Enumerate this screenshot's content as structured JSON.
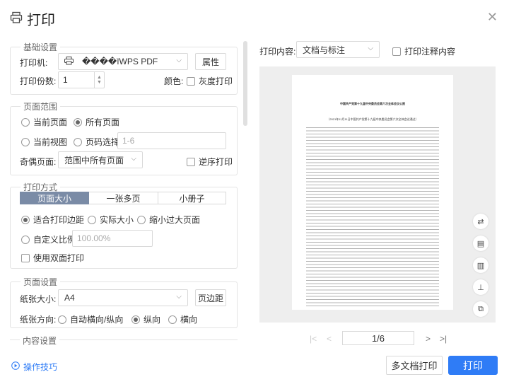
{
  "dialog": {
    "title": "打印"
  },
  "basic": {
    "legend": "基础设置",
    "printer_label": "打印机:",
    "printer_value": "����ĭWPS PDF",
    "props_button": "属性",
    "copies_label": "打印份数:",
    "copies_value": "1",
    "color_label": "颜色:",
    "gray_label": "灰度打印"
  },
  "range": {
    "legend": "页面范围",
    "current_page": "当前页面",
    "all_pages": "所有页面",
    "current_view": "当前视图",
    "page_select": "页码选择:",
    "page_placeholder": "1-6",
    "odd_even_label": "奇偶页面:",
    "odd_even_value": "范围中所有页面",
    "reverse_label": "逆序打印"
  },
  "mode": {
    "legend": "打印方式",
    "tabs": [
      "页面大小",
      "一张多页",
      "小册子"
    ],
    "fit_margin": "适合打印边距",
    "actual_size": "实际大小",
    "shrink": "缩小过大页面",
    "custom_scale": "自定义比例",
    "scale_placeholder": "100.00%",
    "duplex": "使用双面打印"
  },
  "page_setup": {
    "legend": "页面设置",
    "size_label": "纸张大小:",
    "size_value": "A4",
    "margin_button": "页边距",
    "orient_label": "纸张方向:",
    "auto": "自动横向/纵向",
    "portrait": "纵向",
    "landscape": "横向"
  },
  "content": {
    "legend": "内容设置"
  },
  "right": {
    "content_label": "打印内容:",
    "content_value": "文档与标注",
    "annot_label": "打印注释内容"
  },
  "pager": {
    "current": "1/6"
  },
  "footer": {
    "tips": "操作技巧",
    "multi": "多文档打印",
    "print": "打印"
  },
  "doc": {
    "heading": "中国共产党第十九届中央委员会第六次全体会议公报",
    "subtitle": "（2021年11月11日中国共产党第十九届中央委员会第六次全体会议通过）"
  },
  "colors": {
    "accent": "#2f7cf6",
    "tab_active": "#7a8ba6"
  }
}
